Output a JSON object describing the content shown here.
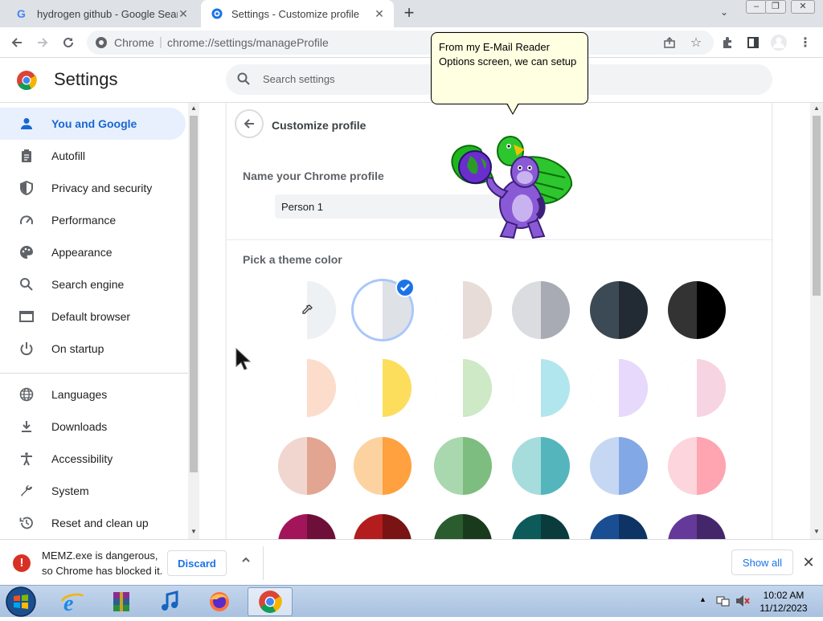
{
  "tabs": [
    {
      "title": "hydrogen github - Google Search",
      "active": false
    },
    {
      "title": "Settings - Customize profile",
      "active": true
    }
  ],
  "toolbar": {
    "site_name": "Chrome",
    "url": "chrome://settings/manageProfile"
  },
  "settings": {
    "title": "Settings",
    "search_placeholder": "Search settings"
  },
  "sidebar": {
    "items": [
      {
        "label": "You and Google",
        "icon": "person-icon",
        "selected": true
      },
      {
        "label": "Autofill",
        "icon": "clipboard-icon",
        "selected": false
      },
      {
        "label": "Privacy and security",
        "icon": "shield-icon",
        "selected": false
      },
      {
        "label": "Performance",
        "icon": "speedometer-icon",
        "selected": false
      },
      {
        "label": "Appearance",
        "icon": "palette-icon",
        "selected": false
      },
      {
        "label": "Search engine",
        "icon": "search-icon",
        "selected": false
      },
      {
        "label": "Default browser",
        "icon": "browser-icon",
        "selected": false
      },
      {
        "label": "On startup",
        "icon": "power-icon",
        "selected": false
      }
    ],
    "items2": [
      {
        "label": "Languages",
        "icon": "globe-icon"
      },
      {
        "label": "Downloads",
        "icon": "download-icon"
      },
      {
        "label": "Accessibility",
        "icon": "accessibility-icon"
      },
      {
        "label": "System",
        "icon": "wrench-icon"
      },
      {
        "label": "Reset and clean up",
        "icon": "history-icon"
      }
    ]
  },
  "profile": {
    "page_title": "Customize profile",
    "name_label": "Name your Chrome profile",
    "name_value": "Person 1",
    "theme_label": "Pick a theme color"
  },
  "theme_colors": [
    {
      "left": "#ffffff",
      "right": "#eef1f4",
      "type": "custom"
    },
    {
      "left": "#ffffff",
      "right": "#dee1e6",
      "type": "selected"
    },
    {
      "left": "#ffffff",
      "right": "#e8dcd8"
    },
    {
      "left": "#dadce0",
      "right": "#a8abb3"
    },
    {
      "left": "#3c4a55",
      "right": "#222b33"
    },
    {
      "left": "#333333",
      "right": "#000000"
    },
    {
      "left": "#ffffff",
      "right": "#fcdccb"
    },
    {
      "left": "#ffffff",
      "right": "#fdde5c"
    },
    {
      "left": "#ffffff",
      "right": "#cde9c6"
    },
    {
      "left": "#ffffff",
      "right": "#b2e6ef"
    },
    {
      "left": "#ffffff",
      "right": "#e6d9fb"
    },
    {
      "left": "#ffffff",
      "right": "#f7d4e2"
    },
    {
      "left": "#f1d6cf",
      "right": "#e2a592"
    },
    {
      "left": "#fcd3a0",
      "right": "#ffa13f"
    },
    {
      "left": "#a9d8ae",
      "right": "#7ebd80"
    },
    {
      "left": "#a6dcdc",
      "right": "#55b5bd"
    },
    {
      "left": "#c5d7f3",
      "right": "#83a8e6"
    },
    {
      "left": "#fdd5dc",
      "right": "#fea5b1"
    },
    {
      "left": "#a3155a",
      "right": "#6e0f3a"
    },
    {
      "left": "#b31d1d",
      "right": "#7a1313"
    },
    {
      "left": "#2a5c2e",
      "right": "#193a1c"
    },
    {
      "left": "#0d5a5a",
      "right": "#0a3b3d"
    },
    {
      "left": "#194e93",
      "right": "#0e3466"
    },
    {
      "left": "#653999",
      "right": "#44276b"
    }
  ],
  "assistant": {
    "bubble_text": "From my E-Mail Reader Options screen, we can setup"
  },
  "download_bar": {
    "message_line1": "MEMZ.exe is dangerous,",
    "message_line2": "so Chrome has blocked it.",
    "discard_label": "Discard",
    "show_all_label": "Show all"
  },
  "taskbar": {
    "time": "10:02 AM",
    "date": "11/12/2023"
  },
  "colors": {
    "accent": "#1a73e8",
    "selected_bg": "#e8f0fe",
    "danger": "#d93025"
  }
}
